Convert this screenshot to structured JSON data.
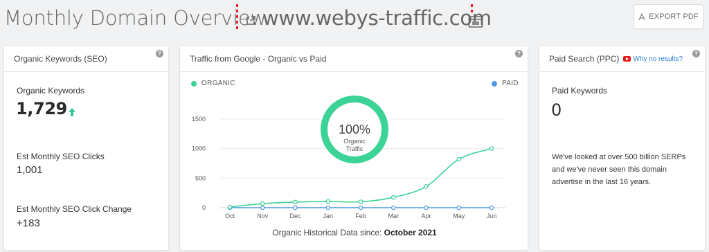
{
  "header": {
    "title": "Monthly Domain Overview",
    "domain": "www.webys-traffic.com",
    "export_label": "EXPORT PDF"
  },
  "icons": {
    "external_link": "external-link-icon",
    "calendar": "calendar-icon",
    "pdf": "pdf-icon",
    "help": "help-icon",
    "youtube": "youtube-icon",
    "up_arrow": "up-arrow-icon"
  },
  "seo_card": {
    "title": "Organic Keywords (SEO)",
    "organic_keywords_label": "Organic Keywords",
    "organic_keywords_value": "1,729",
    "clicks_label": "Est Monthly SEO Clicks",
    "clicks_value": "1,001",
    "change_label": "Est Monthly SEO Click Change",
    "change_value": "+183"
  },
  "traffic_card": {
    "title": "Traffic from Google - Organic vs Paid",
    "legend_organic": "ORGANIC",
    "legend_paid": "PAID",
    "donut_percent": "100%",
    "donut_label_1": "Organic",
    "donut_label_2": "Traffic",
    "donut_fraction": 1.0,
    "footer_prefix": "Organic Historical Data since: ",
    "footer_date": "October 2021"
  },
  "ppc_card": {
    "title": "Paid Search (PPC)",
    "link_label": "Why no results?",
    "paid_keywords_label": "Paid Keywords",
    "paid_keywords_value": "0",
    "description": "We've looked at over 500 billion SERPs and we've never seen this domain advertise in the last 16 years."
  },
  "colors": {
    "organic": "#3cd396",
    "paid": "#4f97e8",
    "arrow": "#35c98c",
    "link": "#2a7ad6"
  },
  "chart_data": {
    "type": "line",
    "categories": [
      "Oct",
      "Nov",
      "Dec",
      "Jan",
      "Feb",
      "Mar",
      "Apr",
      "May",
      "Jun"
    ],
    "series": [
      {
        "name": "ORGANIC",
        "values": [
          10,
          70,
          95,
          105,
          100,
          175,
          360,
          820,
          1001
        ]
      },
      {
        "name": "PAID",
        "values": [
          0,
          0,
          0,
          0,
          0,
          0,
          0,
          0,
          0
        ]
      }
    ],
    "yticks": [
      0,
      500,
      1000,
      1500
    ],
    "ylim": [
      0,
      1500
    ],
    "grid": true
  }
}
